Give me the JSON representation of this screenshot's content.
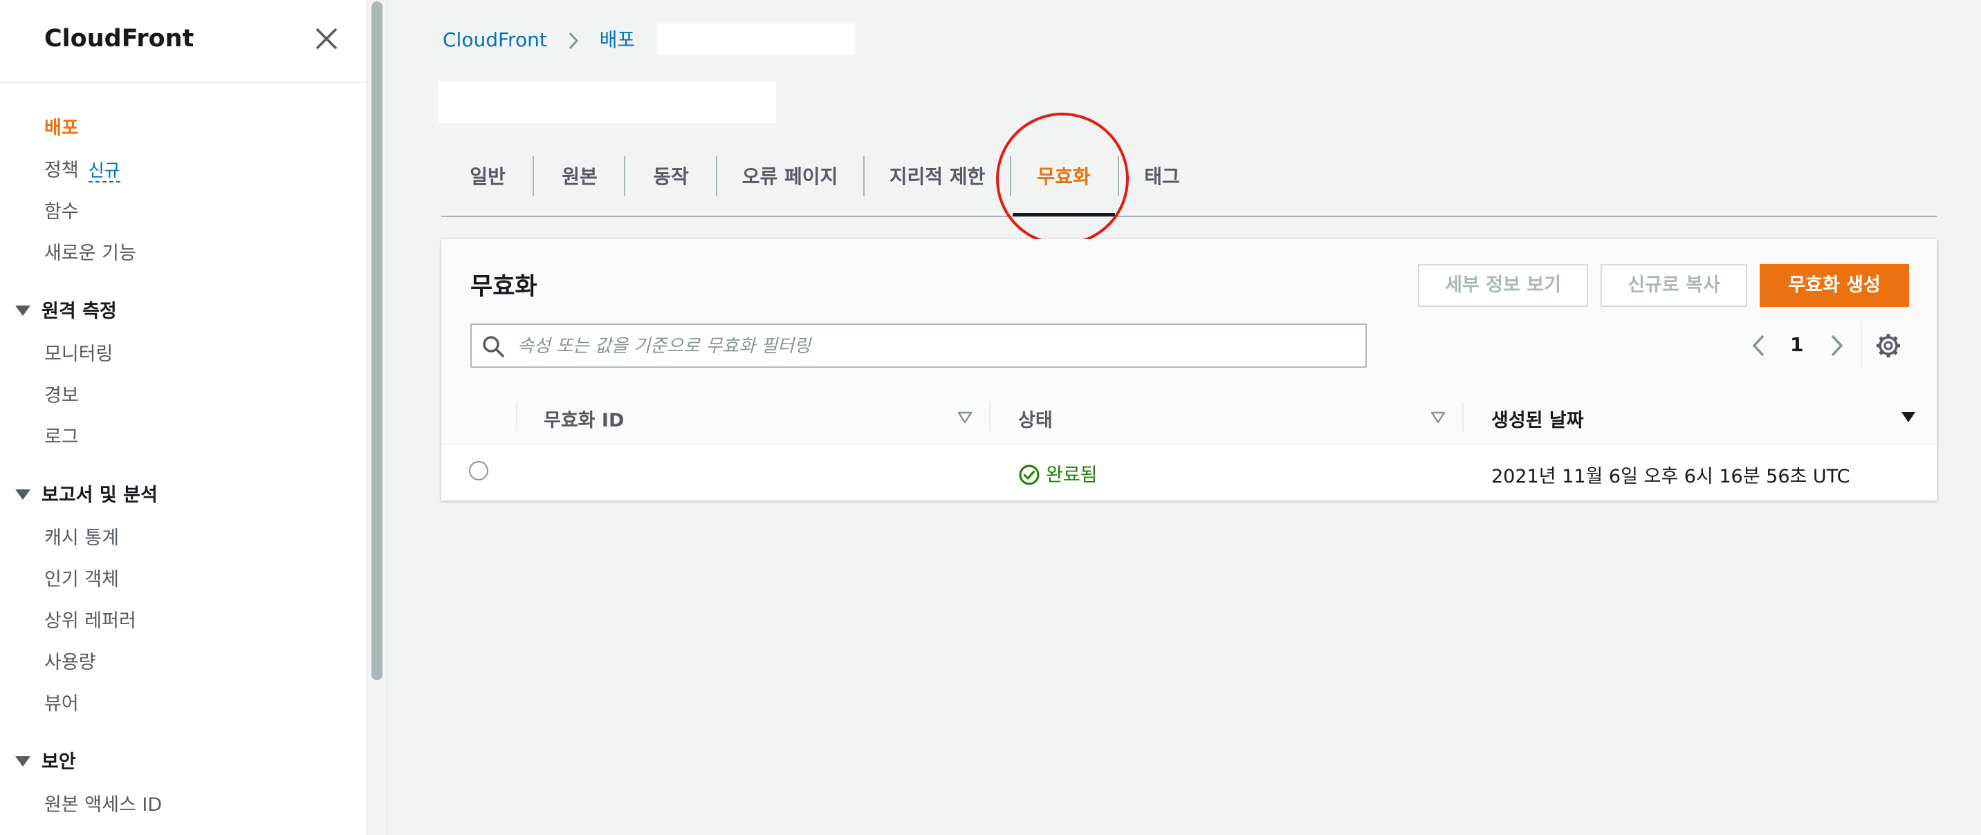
{
  "sidebar": {
    "title": "CloudFront",
    "items_top": [
      {
        "label": "배포",
        "active": true
      },
      {
        "label": "정책",
        "badge": "신규"
      },
      {
        "label": "함수"
      },
      {
        "label": "새로운 기능"
      }
    ],
    "sections": [
      {
        "label": "원격 측정",
        "items": [
          "모니터링",
          "경보",
          "로그"
        ]
      },
      {
        "label": "보고서 및 분석",
        "items": [
          "캐시 통계",
          "인기 객체",
          "상위 레퍼러",
          "사용량",
          "뷰어"
        ]
      },
      {
        "label": "보안",
        "items": [
          "원본 액세스 ID"
        ]
      }
    ]
  },
  "breadcrumb": [
    "CloudFront",
    "배포"
  ],
  "tabs": [
    {
      "label": "일반"
    },
    {
      "label": "원본"
    },
    {
      "label": "동작"
    },
    {
      "label": "오류 페이지"
    },
    {
      "label": "지리적 제한"
    },
    {
      "label": "무효화",
      "active": true
    },
    {
      "label": "태그"
    }
  ],
  "panel": {
    "title": "무효화",
    "buttons": {
      "details": "세부 정보 보기",
      "copy": "신규로 복사",
      "create": "무효화 생성"
    },
    "search_placeholder": "속성 또는 값을 기준으로 무효화 필터링",
    "pagination": {
      "current_page": "1"
    },
    "table": {
      "columns": [
        "무효화 ID",
        "상태",
        "생성된 날짜"
      ],
      "rows": [
        {
          "id": "",
          "status": "완료됨",
          "created": "2021년 11월 6일 오후 6시 16분 56초 UTC"
        }
      ]
    }
  },
  "colors": {
    "accent": "#ec7211",
    "link": "#0073bb",
    "success": "#1d8102",
    "highlight_circle": "#e01e12"
  }
}
